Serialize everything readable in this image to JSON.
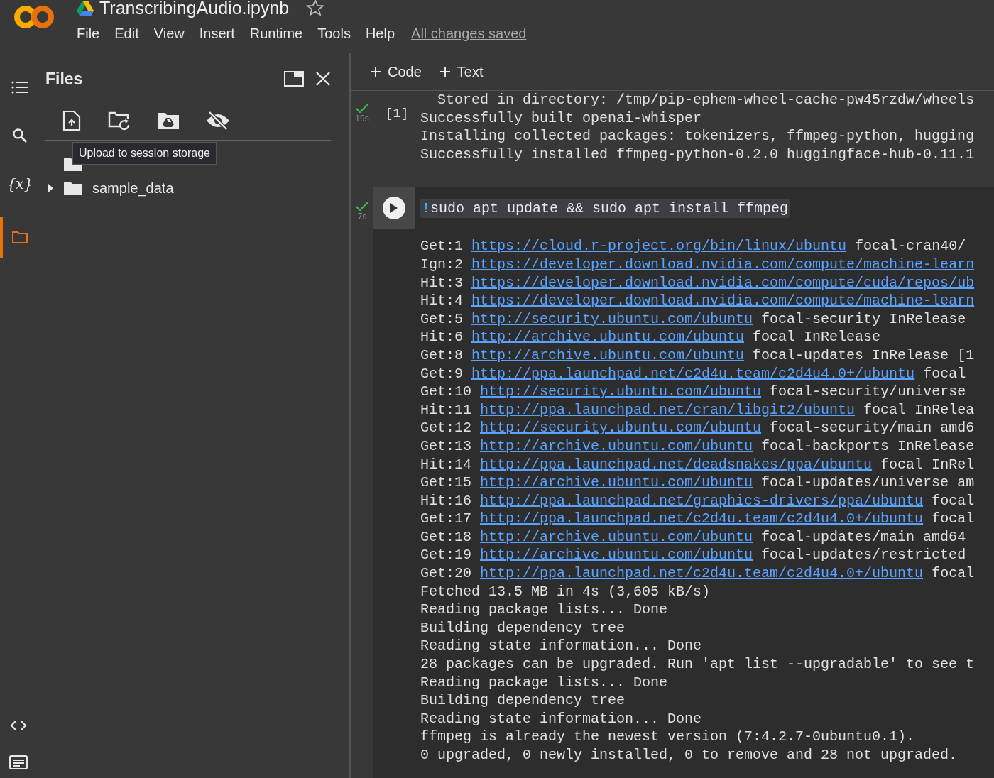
{
  "notebook": {
    "title": "TranscribingAudio.ipynb",
    "starred": false
  },
  "menu": [
    "File",
    "Edit",
    "View",
    "Insert",
    "Runtime",
    "Tools",
    "Help"
  ],
  "save_status": "All changes saved",
  "sidebar": {
    "items": [
      {
        "kind": "toc",
        "selected": false
      },
      {
        "kind": "search",
        "selected": false
      },
      {
        "kind": "variables",
        "label": "{x}",
        "selected": false
      },
      {
        "kind": "files",
        "selected": true
      }
    ],
    "bottom": [
      {
        "kind": "code"
      },
      {
        "kind": "terminal"
      }
    ]
  },
  "files_panel": {
    "title": "Files",
    "tooltip": "Upload to session storage",
    "tree": [
      {
        "kind": "parent"
      },
      {
        "kind": "folder",
        "name": "sample_data",
        "expanded": false
      }
    ]
  },
  "toolbar": [
    "Code",
    "Text"
  ],
  "cells": [
    {
      "succeeded": true,
      "time": "19s",
      "execution_count": "[1]",
      "output": [
        {
          "text": "  Stored in directory: /tmp/pip-ephem-wheel-cache-pw45rzdw/wheels"
        },
        {
          "text": "Successfully built openai-whisper"
        },
        {
          "text": "Installing collected packages: tokenizers, ffmpeg-python, hugging"
        },
        {
          "text": "Successfully installed ffmpeg-python-0.2.0 huggingface-hub-0.11.1"
        }
      ]
    },
    {
      "succeeded": true,
      "time": "7s",
      "code": "!sudo apt update && sudo apt install ffmpeg",
      "output": [
        {
          "prefix": "Get:1 ",
          "link": "https://cloud.r-project.org/bin/linux/ubuntu",
          "rest": " focal-cran40/"
        },
        {
          "prefix": "Ign:2 ",
          "link": "https://developer.download.nvidia.com/compute/machine-learn"
        },
        {
          "prefix": "Hit:3 ",
          "link": "https://developer.download.nvidia.com/compute/cuda/repos/ub"
        },
        {
          "prefix": "Hit:4 ",
          "link": "https://developer.download.nvidia.com/compute/machine-learn"
        },
        {
          "prefix": "Get:5 ",
          "link": "http://security.ubuntu.com/ubuntu",
          "rest": " focal-security InRelease"
        },
        {
          "prefix": "Hit:6 ",
          "link": "http://archive.ubuntu.com/ubuntu",
          "rest": " focal InRelease"
        },
        {
          "prefix": "Get:8 ",
          "link": "http://archive.ubuntu.com/ubuntu",
          "rest": " focal-updates InRelease [1"
        },
        {
          "prefix": "Get:9 ",
          "link": "http://ppa.launchpad.net/c2d4u.team/c2d4u4.0+/ubuntu",
          "rest": " focal"
        },
        {
          "prefix": "Get:10 ",
          "link": "http://security.ubuntu.com/ubuntu",
          "rest": " focal-security/universe"
        },
        {
          "prefix": "Hit:11 ",
          "link": "http://ppa.launchpad.net/cran/libgit2/ubuntu",
          "rest": " focal InRelea"
        },
        {
          "prefix": "Get:12 ",
          "link": "http://security.ubuntu.com/ubuntu",
          "rest": " focal-security/main amd6"
        },
        {
          "prefix": "Get:13 ",
          "link": "http://archive.ubuntu.com/ubuntu",
          "rest": " focal-backports InRelease"
        },
        {
          "prefix": "Hit:14 ",
          "link": "http://ppa.launchpad.net/deadsnakes/ppa/ubuntu",
          "rest": " focal InRel"
        },
        {
          "prefix": "Get:15 ",
          "link": "http://archive.ubuntu.com/ubuntu",
          "rest": " focal-updates/universe am"
        },
        {
          "prefix": "Hit:16 ",
          "link": "http://ppa.launchpad.net/graphics-drivers/ppa/ubuntu",
          "rest": " focal"
        },
        {
          "prefix": "Get:17 ",
          "link": "http://ppa.launchpad.net/c2d4u.team/c2d4u4.0+/ubuntu",
          "rest": " focal"
        },
        {
          "prefix": "Get:18 ",
          "link": "http://archive.ubuntu.com/ubuntu",
          "rest": " focal-updates/main amd64"
        },
        {
          "prefix": "Get:19 ",
          "link": "http://archive.ubuntu.com/ubuntu",
          "rest": " focal-updates/restricted"
        },
        {
          "prefix": "Get:20 ",
          "link": "http://ppa.launchpad.net/c2d4u.team/c2d4u4.0+/ubuntu",
          "rest": " focal"
        },
        {
          "text": "Fetched 13.5 MB in 4s (3,605 kB/s)"
        },
        {
          "text": "Reading package lists... Done"
        },
        {
          "text": "Building dependency tree"
        },
        {
          "text": "Reading state information... Done"
        },
        {
          "text": "28 packages can be upgraded. Run 'apt list --upgradable' to see t"
        },
        {
          "text": "Reading package lists... Done"
        },
        {
          "text": "Building dependency tree"
        },
        {
          "text": "Reading state information... Done"
        },
        {
          "text": "ffmpeg is already the newest version (7:4.2.7-0ubuntu0.1)."
        },
        {
          "text": "0 upgraded, 0 newly installed, 0 to remove and 28 not upgraded."
        }
      ]
    }
  ]
}
